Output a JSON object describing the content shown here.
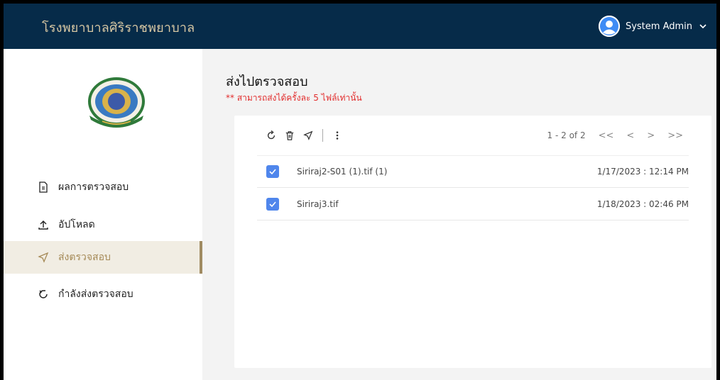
{
  "header": {
    "brand": "โรงพยาบาลศิริราชพยาบาล",
    "user_name": "System Admin"
  },
  "sidebar": {
    "logo_icon": "siriraj-hospital-seal",
    "items": [
      {
        "label": "ผลการตรวจสอบ",
        "icon": "document-icon",
        "active": false
      },
      {
        "label": "อัปโหลด",
        "icon": "upload-icon",
        "active": false
      },
      {
        "label": "ส่งตรวจสอบ",
        "icon": "send-icon",
        "active": true
      },
      {
        "label": "กำลังส่งตรวจสอบ",
        "icon": "refresh-icon",
        "active": false
      }
    ]
  },
  "main": {
    "title": "ส่งไปตรวจสอบ",
    "warning": "** สามารถส่งได้ครั้งละ 5 ไฟล์เท่านั้น",
    "toolbar": [
      "refresh-icon",
      "delete-icon",
      "send-icon",
      "more-vertical-icon"
    ],
    "pager": {
      "range": "1 - 2 of 2",
      "first": "<<",
      "prev": "<",
      "next": ">",
      "last": ">>"
    },
    "files": [
      {
        "name": "Siriraj2-S01 (1).tif (1)",
        "date": "1/17/2023 : 12:14 PM",
        "checked": true
      },
      {
        "name": "Siriraj3.tif",
        "date": "1/18/2023 : 02:46 PM",
        "checked": true
      }
    ]
  },
  "colors": {
    "header_bg": "#062b49",
    "brand_text": "#d7c7a3",
    "active_bg": "#f1ede3",
    "active_text": "#a58a57",
    "warning": "#e22d2d",
    "checkbox": "#4f86ec"
  }
}
